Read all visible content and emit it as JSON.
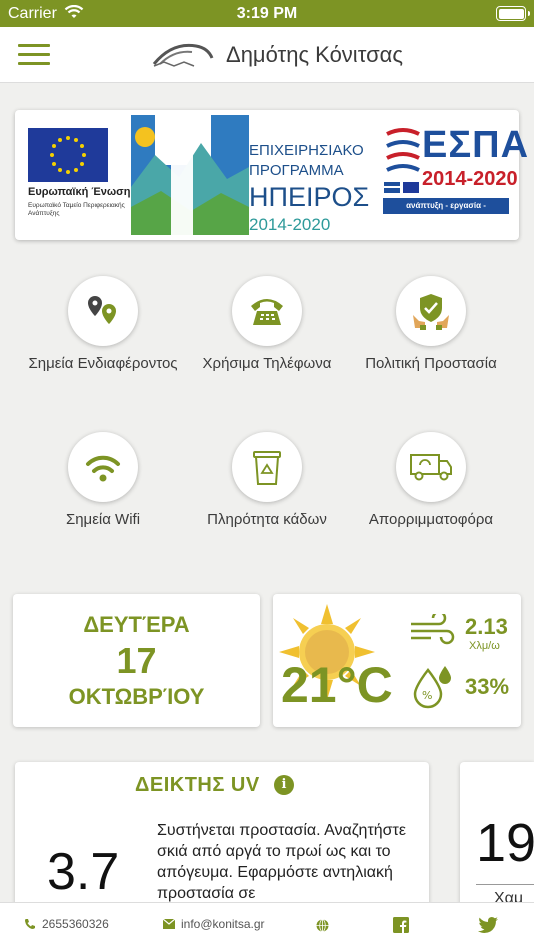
{
  "status_bar": {
    "carrier": "Carrier",
    "time": "3:19 PM"
  },
  "header": {
    "title": "Δημότης Κόνιτσας"
  },
  "banner": {
    "eu_name": "Ευρωπαϊκή Ένωση",
    "eu_subtitle": "Ευρωπαϊκό Ταμείο Περιφερειακής Ανάπτυξης",
    "program_line1": "ΕΠΙΧΕΙΡΗΣΙΑΚΟ",
    "program_line2": "ΠΡΟΓΡΑΜΜΑ",
    "program_region": "ΗΠΕΙΡΟΣ",
    "program_years": "2014-2020",
    "espa_title": "ΕΣΠΑ",
    "espa_years": "2014-2020",
    "espa_slogan": "ανάπτυξη - εργασία - αλληλεγγύη"
  },
  "menu_items": [
    {
      "label": "Σημεία Ενδιαφέροντος",
      "icon": "map-pins-icon"
    },
    {
      "label": "Χρήσιμα Τηλέφωνα",
      "icon": "telephone-icon"
    },
    {
      "label": "Πολιτική Προστασία",
      "icon": "shield-hands-icon"
    },
    {
      "label": "Σημεία Wifi",
      "icon": "wifi-icon"
    },
    {
      "label": "Πληρότητα κάδων",
      "icon": "recycle-bin-icon"
    },
    {
      "label": "Απορριμματοφόρα",
      "icon": "garbage-truck-icon"
    }
  ],
  "date_card": {
    "day": "ΔΕΥΤΈΡΑ",
    "date": "17",
    "month": "ΟΚΤΩΒΡΊΟΥ"
  },
  "weather_card": {
    "temperature": "21°C",
    "wind": "2.13",
    "wind_unit": "Χλμ/ω",
    "humidity": "33%"
  },
  "uv_card": {
    "title": "ΔΕΙΚΤΗΣ UV",
    "value": "3.7",
    "description": "Συστήνεται προστασία. Αναζητήστε σκιά από αργά το πρωί ως και το απόγευμα. Εφαρμόστε αντηλιακή προστασία σε"
  },
  "second_card": {
    "number": "19",
    "label": "Χαμ"
  },
  "footer": {
    "phone": "2655360326",
    "email": "info@konitsa.gr"
  },
  "colors": {
    "brand_green": "#7d9424",
    "eu_blue": "#1f3a9a",
    "espa_red": "#c8202a"
  }
}
